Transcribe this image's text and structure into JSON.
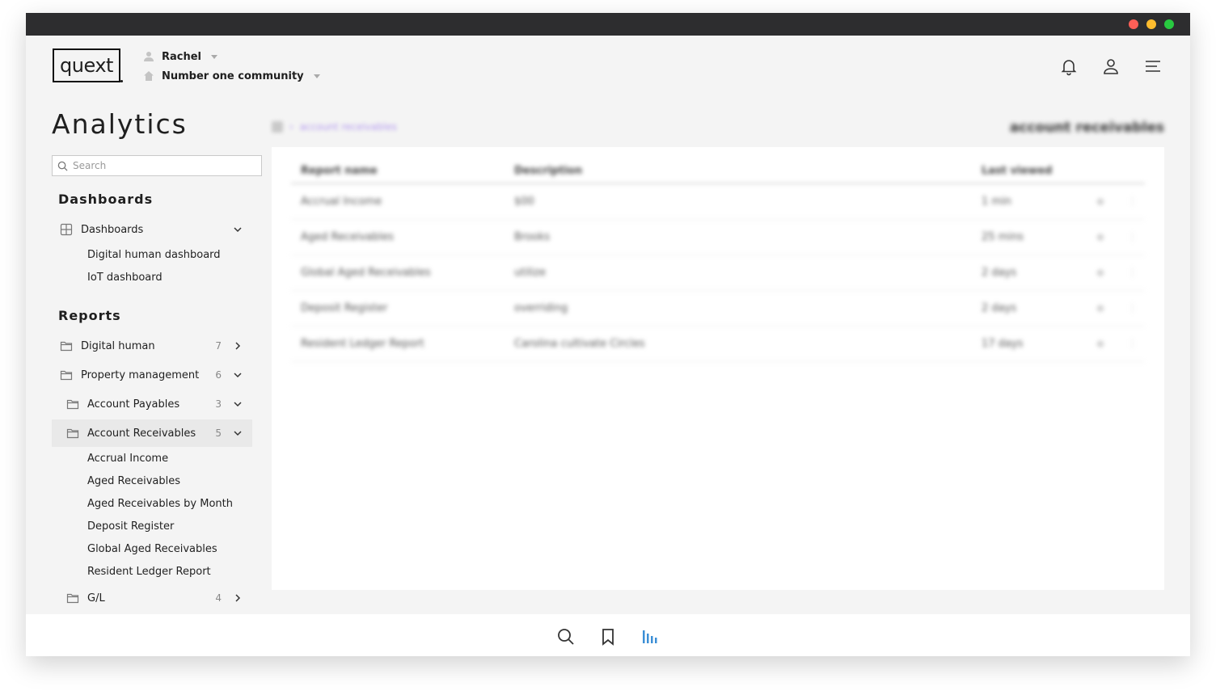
{
  "header": {
    "logo_text": "quext",
    "user_name": "Rachel",
    "community_name": "Number one community",
    "icons": [
      "bell-icon",
      "user-icon",
      "menu-icon"
    ]
  },
  "page_title": "Analytics",
  "search": {
    "placeholder": "Search"
  },
  "dashboards": {
    "heading": "Dashboards",
    "group_label": "Dashboards",
    "items": [
      "Digital human dashboard",
      "IoT dashboard"
    ]
  },
  "reports": {
    "heading": "Reports",
    "groups": [
      {
        "label": "Digital human",
        "count": "7"
      },
      {
        "label": "Property management",
        "count": "6"
      },
      {
        "label": "Account Payables",
        "count": "3"
      },
      {
        "label": "Account Receivables",
        "count": "5"
      },
      {
        "label": "G/L",
        "count": "4"
      }
    ],
    "receivables_items": [
      "Accrual Income",
      "Aged Receivables",
      "Aged Receivables by Month",
      "Deposit Register",
      "Global Aged Receivables",
      "Resident Ledger Report"
    ]
  },
  "breadcrumb": {
    "current": "account receivables"
  },
  "content_title": "account receivables",
  "table": {
    "headers": {
      "name": "Report name",
      "description": "Description",
      "last_viewed": "Last viewed"
    },
    "rows": [
      {
        "name": "Accrual Income",
        "description": "$00",
        "last_viewed": "1 min"
      },
      {
        "name": "Aged Receivables",
        "description": "Brooks",
        "last_viewed": "25 mins"
      },
      {
        "name": "Global Aged Receivables",
        "description": "utilize",
        "last_viewed": "2 days"
      },
      {
        "name": "Deposit Register",
        "description": "overriding",
        "last_viewed": "2 days"
      },
      {
        "name": "Resident Ledger Report",
        "description": "Carolina cultivate Circles",
        "last_viewed": "17 days"
      }
    ]
  },
  "colors": {
    "accent": "#3c8fd6",
    "breadcrumb_link": "#b59cf0",
    "selected_row": "#e9e9e9",
    "titlebar": "#2d2d2f"
  }
}
